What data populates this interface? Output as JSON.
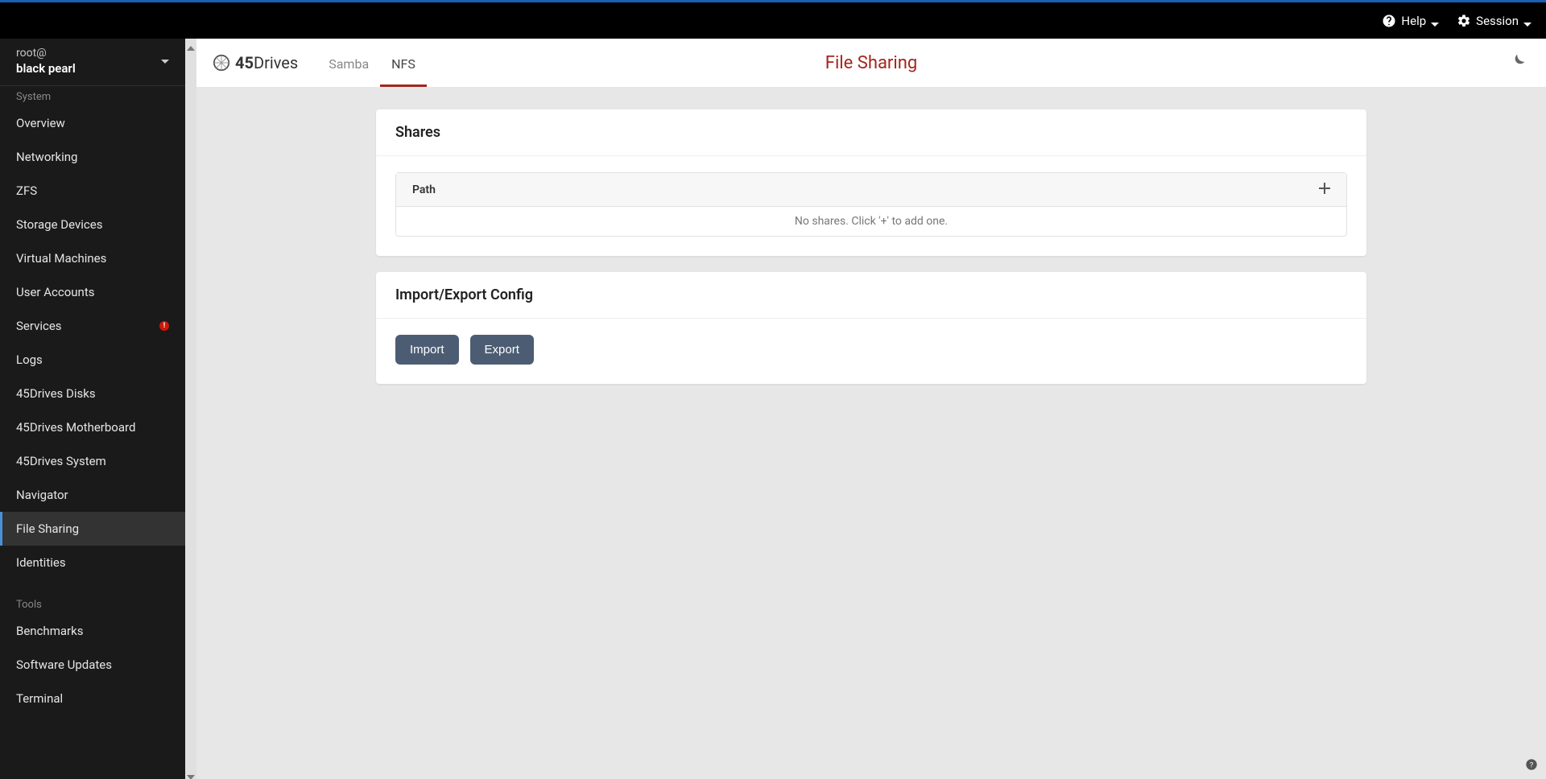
{
  "topbar": {
    "help_label": "Help",
    "session_label": "Session"
  },
  "sidebar": {
    "user": "root@",
    "host": "black pearl",
    "section_system": "System",
    "section_tools": "Tools",
    "items": [
      {
        "label": "Overview",
        "badge": false,
        "active": false
      },
      {
        "label": "Networking",
        "badge": false,
        "active": false
      },
      {
        "label": "ZFS",
        "badge": false,
        "active": false
      },
      {
        "label": "Storage Devices",
        "badge": false,
        "active": false
      },
      {
        "label": "Virtual Machines",
        "badge": false,
        "active": false
      },
      {
        "label": "User Accounts",
        "badge": false,
        "active": false
      },
      {
        "label": "Services",
        "badge": true,
        "active": false
      },
      {
        "label": "Logs",
        "badge": false,
        "active": false
      },
      {
        "label": "45Drives Disks",
        "badge": false,
        "active": false
      },
      {
        "label": "45Drives Motherboard",
        "badge": false,
        "active": false
      },
      {
        "label": "45Drives System",
        "badge": false,
        "active": false
      },
      {
        "label": "Navigator",
        "badge": false,
        "active": false
      },
      {
        "label": "File Sharing",
        "badge": false,
        "active": true
      },
      {
        "label": "Identities",
        "badge": false,
        "active": false
      }
    ],
    "tools": [
      {
        "label": "Benchmarks"
      },
      {
        "label": "Software Updates"
      },
      {
        "label": "Terminal"
      }
    ]
  },
  "header": {
    "brand_prefix": "45",
    "brand_suffix": "Drives",
    "tabs": [
      {
        "label": "Samba",
        "active": false
      },
      {
        "label": "NFS",
        "active": true
      }
    ],
    "title": "File Sharing"
  },
  "shares_card": {
    "heading": "Shares",
    "path_col": "Path",
    "empty_message": "No shares. Click '+' to add one."
  },
  "config_card": {
    "heading": "Import/Export Config",
    "import_label": "Import",
    "export_label": "Export"
  }
}
